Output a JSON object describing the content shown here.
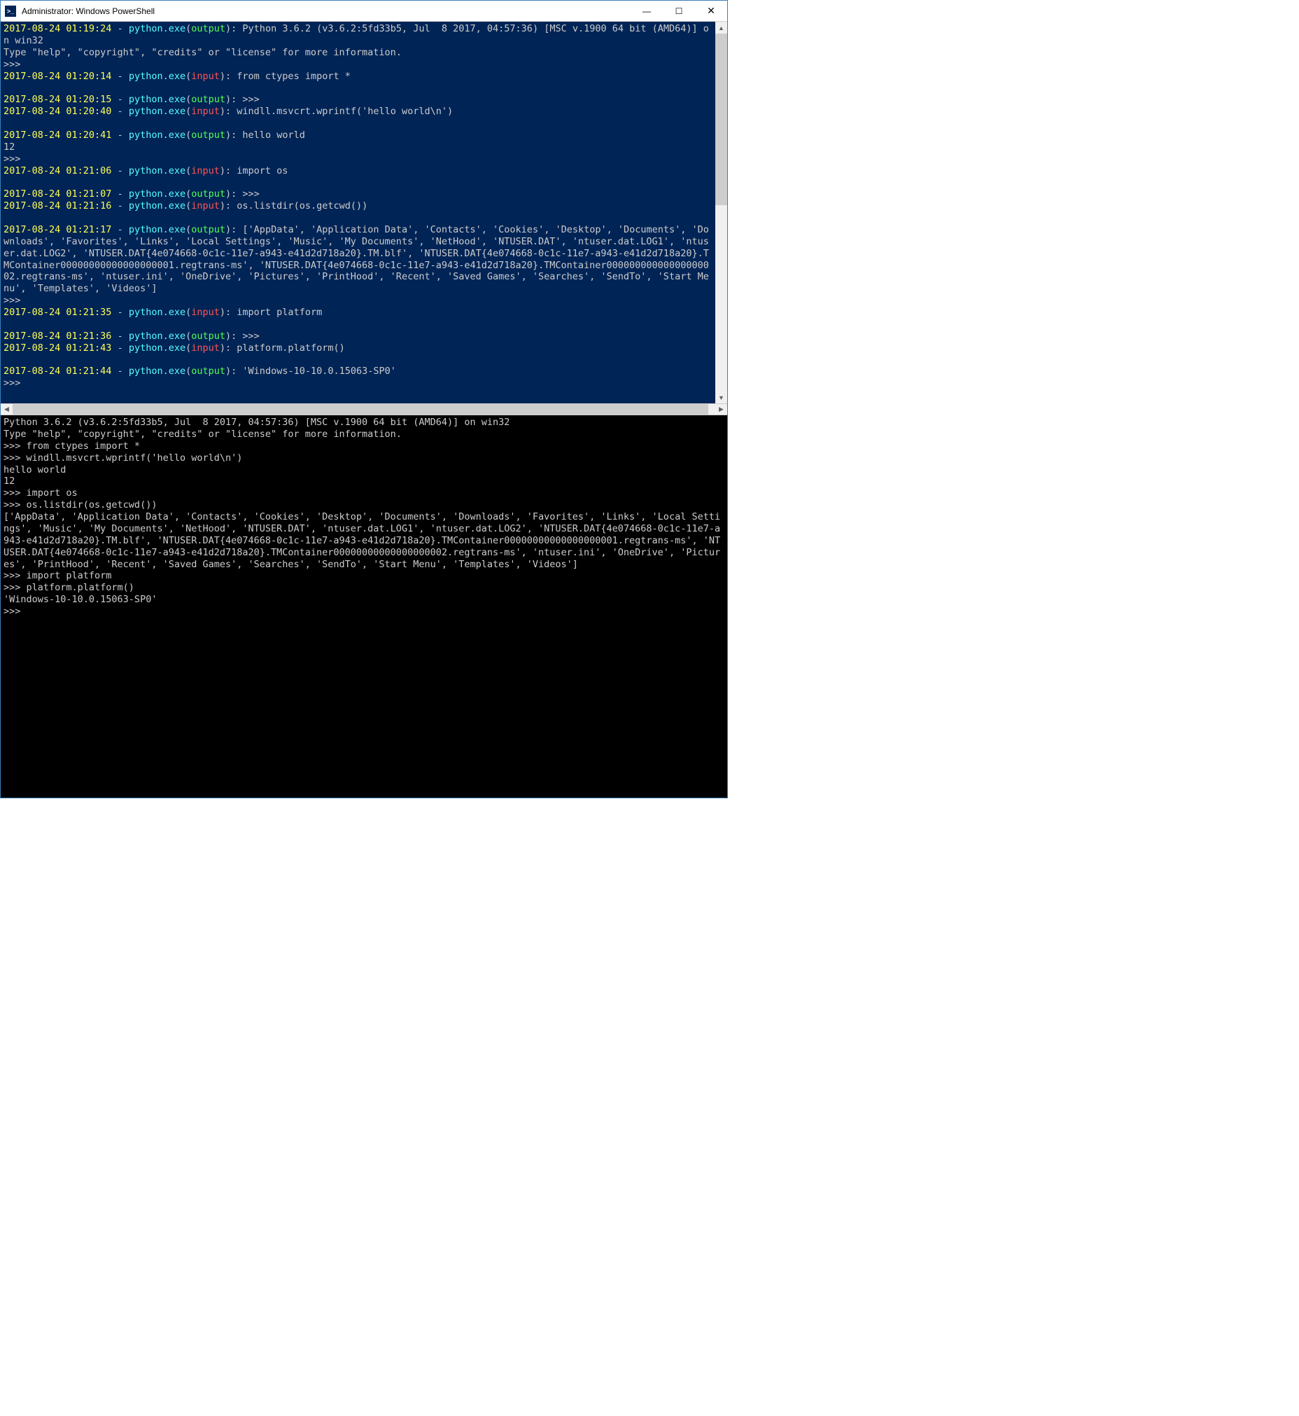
{
  "window": {
    "title": "Administrator: Windows PowerShell",
    "icon_label": ">_",
    "minimize": "—",
    "maximize": "☐",
    "close": "✕"
  },
  "colors": {
    "ps_bg": "#012456",
    "timestamp": "#ffff55",
    "process": "#55ffff",
    "output": "#55ff55",
    "input": "#ff5555"
  },
  "top_lines": [
    {
      "type": "log",
      "ts": "2017-08-24 01:19:24",
      "proc": "python.exe",
      "io": "output",
      "rest": ": Python 3.6.2 (v3.6.2:5fd33b5, Jul  8 2017, 04:57:36) [MSC v.1900 64 bit (AMD64)] on win32"
    },
    {
      "type": "plain",
      "text": "Type \"help\", \"copyright\", \"credits\" or \"license\" for more information."
    },
    {
      "type": "plain",
      "text": ">>>"
    },
    {
      "type": "log",
      "ts": "2017-08-24 01:20:14",
      "proc": "python.exe",
      "io": "input",
      "rest": ": from ctypes import *"
    },
    {
      "type": "blank"
    },
    {
      "type": "log",
      "ts": "2017-08-24 01:20:15",
      "proc": "python.exe",
      "io": "output",
      "rest": ": >>>"
    },
    {
      "type": "log",
      "ts": "2017-08-24 01:20:40",
      "proc": "python.exe",
      "io": "input",
      "rest": ": windll.msvcrt.wprintf('hello world\\n')"
    },
    {
      "type": "blank"
    },
    {
      "type": "log",
      "ts": "2017-08-24 01:20:41",
      "proc": "python.exe",
      "io": "output",
      "rest": ": hello world"
    },
    {
      "type": "plain",
      "text": "12"
    },
    {
      "type": "plain",
      "text": ">>>"
    },
    {
      "type": "log",
      "ts": "2017-08-24 01:21:06",
      "proc": "python.exe",
      "io": "input",
      "rest": ": import os"
    },
    {
      "type": "blank"
    },
    {
      "type": "log",
      "ts": "2017-08-24 01:21:07",
      "proc": "python.exe",
      "io": "output",
      "rest": ": >>>"
    },
    {
      "type": "log",
      "ts": "2017-08-24 01:21:16",
      "proc": "python.exe",
      "io": "input",
      "rest": ": os.listdir(os.getcwd())"
    },
    {
      "type": "blank"
    },
    {
      "type": "log",
      "ts": "2017-08-24 01:21:17",
      "proc": "python.exe",
      "io": "output",
      "rest": ": ['AppData', 'Application Data', 'Contacts', 'Cookies', 'Desktop', 'Documents', 'Downloads', 'Favorites', 'Links', 'Local Settings', 'Music', 'My Documents', 'NetHood', 'NTUSER.DAT', 'ntuser.dat.LOG1', 'ntuser.dat.LOG2', 'NTUSER.DAT{4e074668-0c1c-11e7-a943-e41d2d718a20}.TM.blf', 'NTUSER.DAT{4e074668-0c1c-11e7-a943-e41d2d718a20}.TMContainer00000000000000000001.regtrans-ms', 'NTUSER.DAT{4e074668-0c1c-11e7-a943-e41d2d718a20}.TMContainer00000000000000000002.regtrans-ms', 'ntuser.ini', 'OneDrive', 'Pictures', 'PrintHood', 'Recent', 'Saved Games', 'Searches', 'SendTo', 'Start Menu', 'Templates', 'Videos']"
    },
    {
      "type": "plain",
      "text": ">>>"
    },
    {
      "type": "log",
      "ts": "2017-08-24 01:21:35",
      "proc": "python.exe",
      "io": "input",
      "rest": ": import platform"
    },
    {
      "type": "blank"
    },
    {
      "type": "log",
      "ts": "2017-08-24 01:21:36",
      "proc": "python.exe",
      "io": "output",
      "rest": ": >>>"
    },
    {
      "type": "log",
      "ts": "2017-08-24 01:21:43",
      "proc": "python.exe",
      "io": "input",
      "rest": ": platform.platform()"
    },
    {
      "type": "blank"
    },
    {
      "type": "log",
      "ts": "2017-08-24 01:21:44",
      "proc": "python.exe",
      "io": "output",
      "rest": ": 'Windows-10-10.0.15063-SP0'"
    },
    {
      "type": "plain",
      "text": ">>>"
    }
  ],
  "bottom_lines": [
    "Python 3.6.2 (v3.6.2:5fd33b5, Jul  8 2017, 04:57:36) [MSC v.1900 64 bit (AMD64)] on win32",
    "Type \"help\", \"copyright\", \"credits\" or \"license\" for more information.",
    ">>> from ctypes import *",
    ">>> windll.msvcrt.wprintf('hello world\\n')",
    "hello world",
    "12",
    ">>> import os",
    ">>> os.listdir(os.getcwd())",
    "['AppData', 'Application Data', 'Contacts', 'Cookies', 'Desktop', 'Documents', 'Downloads', 'Favorites', 'Links', 'Local Settings', 'Music', 'My Documents', 'NetHood', 'NTUSER.DAT', 'ntuser.dat.LOG1', 'ntuser.dat.LOG2', 'NTUSER.DAT{4e074668-0c1c-11e7-a943-e41d2d718a20}.TM.blf', 'NTUSER.DAT{4e074668-0c1c-11e7-a943-e41d2d718a20}.TMContainer00000000000000000001.regtrans-ms', 'NTUSER.DAT{4e074668-0c1c-11e7-a943-e41d2d718a20}.TMContainer00000000000000000002.regtrans-ms', 'ntuser.ini', 'OneDrive', 'Pictures', 'PrintHood', 'Recent', 'Saved Games', 'Searches', 'SendTo', 'Start Menu', 'Templates', 'Videos']",
    ">>> import platform",
    ">>> platform.platform()",
    "'Windows-10-10.0.15063-SP0'",
    ">>>"
  ],
  "scroll": {
    "left_arrow": "◀",
    "right_arrow": "▶",
    "up_arrow": "▲",
    "down_arrow": "▼"
  }
}
